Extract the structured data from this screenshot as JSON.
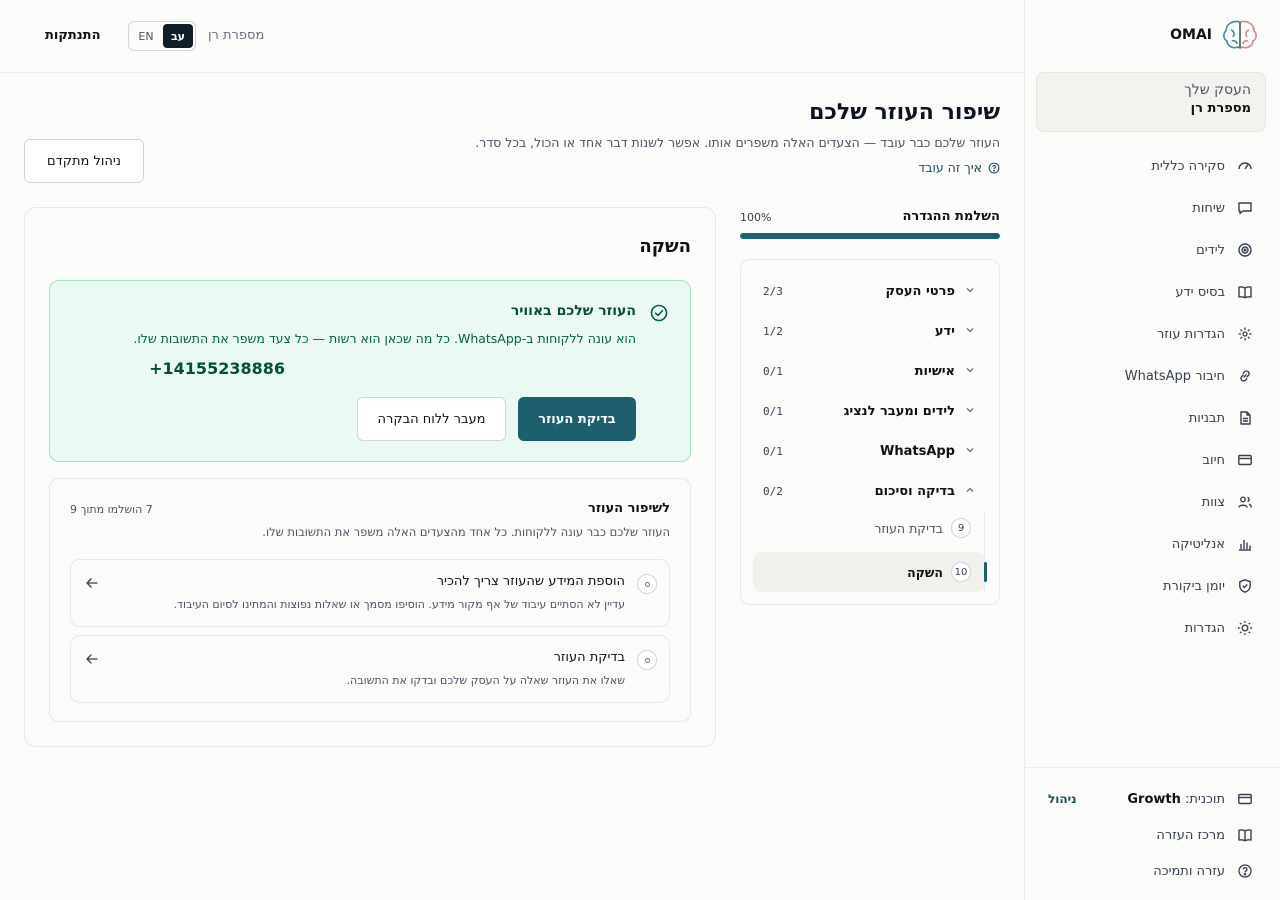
{
  "brand": {
    "name": "OMAI"
  },
  "sidebar": {
    "business_label": "העסק  שלך",
    "business_name": "מספרת רן",
    "items": [
      {
        "label": "סקירה כללית",
        "icon": "gauge-icon"
      },
      {
        "label": "שיחות",
        "icon": "chat-icon"
      },
      {
        "label": "לידים",
        "icon": "target-icon"
      },
      {
        "label": "בסיס ידע",
        "icon": "book-icon"
      },
      {
        "label": "הגדרות עוזר",
        "icon": "sparkle-icon"
      },
      {
        "label": "חיבור WhatsApp",
        "icon": "link-icon"
      },
      {
        "label": "תבניות",
        "icon": "file-icon"
      },
      {
        "label": "חיוב",
        "icon": "credit-card-icon"
      },
      {
        "label": "צוות",
        "icon": "users-icon"
      },
      {
        "label": "אנליטיקה",
        "icon": "bar-chart-icon"
      },
      {
        "label": "יומן ביקורת",
        "icon": "shield-icon"
      },
      {
        "label": "הגדרות",
        "icon": "sun-icon"
      }
    ],
    "footer": {
      "plan_label": "תוכנית:",
      "plan_value": "Growth",
      "plan_manage": "ניהול",
      "help_center": "מרכז העזרה",
      "help_support": "עזרה ותמיכה"
    }
  },
  "topbar": {
    "logout": "התנתקות",
    "lang_en": "EN",
    "lang_he": "עב",
    "business_name": "מספרת רן"
  },
  "header": {
    "title": "שיפור העוזר שלכם",
    "subtitle": "העוזר שלכם כבר עובד — הצעדים האלה משפרים אותו. אפשר לשנות דבר אחד או הכול, בכל סדר.",
    "how_it_works": "איך זה עובד",
    "advanced_button": "ניהול מתקדם"
  },
  "progress": {
    "label": "השלמת ההגדרה",
    "percent_text": "100%",
    "percent": 100,
    "steps": [
      {
        "name": "פרטי העסק",
        "count": "2/3",
        "expanded": false
      },
      {
        "name": "ידע",
        "count": "1/2",
        "expanded": false
      },
      {
        "name": "אישיות",
        "count": "0/1",
        "expanded": false
      },
      {
        "name": "לידים ומעבר לנציג",
        "count": "0/1",
        "expanded": false
      },
      {
        "name": "WhatsApp",
        "count": "0/1",
        "expanded": false
      },
      {
        "name": "בדיקה וסיכום",
        "count": "0/2",
        "expanded": true
      }
    ],
    "substeps": [
      {
        "num": "9",
        "label": "בדיקת העוזר",
        "active": false
      },
      {
        "num": "10",
        "label": "השקה",
        "active": true
      }
    ]
  },
  "launch": {
    "title": "השקה",
    "live_title": "העוזר שלכם באוויר",
    "live_desc": "הוא עונה ללקוחות ב-WhatsApp. כל מה שכאן הוא רשות — כל צעד משפר את התשובות שלו.",
    "phone": "+14155238886",
    "test_button": "בדיקת העוזר",
    "dashboard_button": "מעבר ללוח הבקרה",
    "improve_title": "לשיפור העוזר",
    "improve_count": "7 הושלמו מתוך 9",
    "improve_desc": "העוזר שלכם כבר עונה ללקוחות. כל אחד מהצעדים האלה משפר את התשובות שלו.",
    "tasks": [
      {
        "title": "הוספת המידע שהעוזר צריך להכיר",
        "desc": "עדיין לא הסתיים עיבוד של אף מקור מידע. הוסיפו מסמך או שאלות נפוצות והמתינו לסיום העיבוד."
      },
      {
        "title": "בדיקת העוזר",
        "desc": "שאלו את העוזר שאלה על העסק שלכם ובדקו את התשובה."
      }
    ]
  },
  "colors": {
    "accent": "#1e5f6e",
    "success_bg": "#eafaf3",
    "success_border": "#a7e1c4",
    "success_text": "#064e3b"
  }
}
